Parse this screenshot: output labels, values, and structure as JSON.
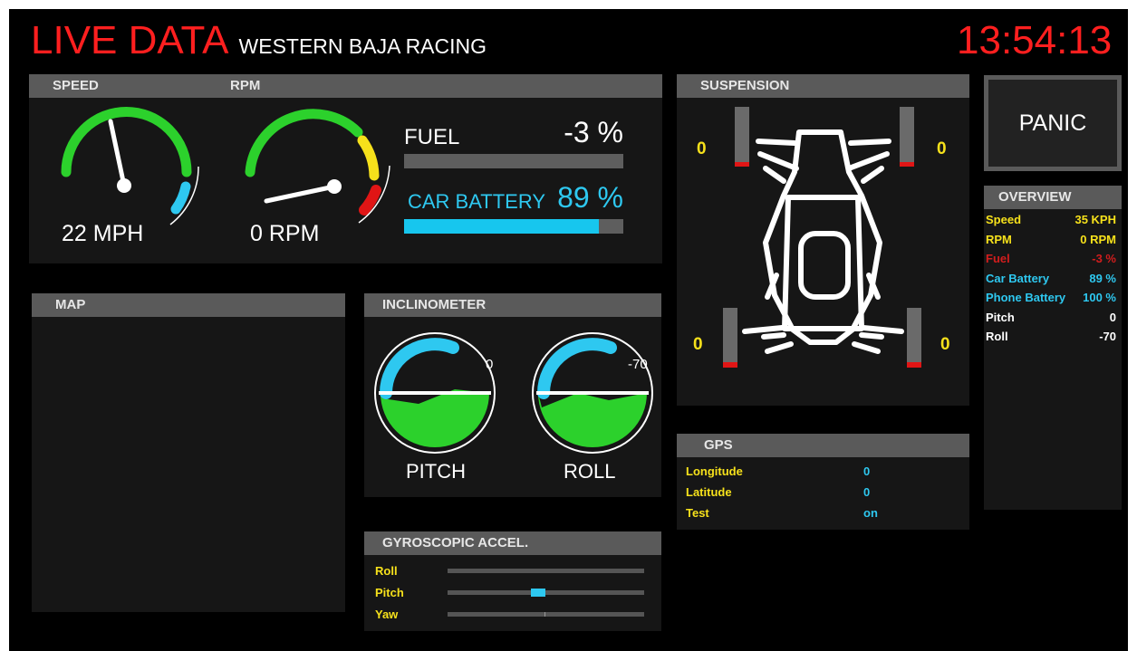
{
  "header": {
    "live_title": "LIVE DATA",
    "team_name": "WESTERN BAJA RACING",
    "clock": "13:54:13"
  },
  "panels": {
    "speed_label": "SPEED",
    "rpm_label": "RPM",
    "suspension_label": "SUSPENSION",
    "map_label": "MAP",
    "inclinometer_label": "INCLINOMETER",
    "gps_label": "GPS",
    "gyro_label": "GYROSCOPIC ACCEL.",
    "overview_label": "OVERVIEW"
  },
  "gauges": {
    "speed_text": "22 MPH",
    "rpm_text": "0 RPM"
  },
  "fuel": {
    "label": "FUEL",
    "value": "-3 %",
    "fraction": 0.0
  },
  "battery": {
    "label": "CAR BATTERY",
    "value": "89 %",
    "fraction": 0.89
  },
  "panic_label": "PANIC",
  "suspension": {
    "front_left": "0",
    "front_right": "0",
    "rear_left": "0",
    "rear_right": "0"
  },
  "overview": {
    "rows": [
      {
        "label": "Speed",
        "value": "35 KPH",
        "color": "#f6e11b"
      },
      {
        "label": "RPM",
        "value": "0 RPM",
        "color": "#f6e11b"
      },
      {
        "label": "Fuel",
        "value": "-3 %",
        "color": "#d21d1d"
      },
      {
        "label": "Car Battery",
        "value": "89 %",
        "color": "#2ec8f0"
      },
      {
        "label": "Phone Battery",
        "value": "100 %",
        "color": "#2ec8f0"
      },
      {
        "label": "Pitch",
        "value": "0",
        "color": "#ffffff"
      },
      {
        "label": "Roll",
        "value": "-70",
        "color": "#ffffff"
      }
    ]
  },
  "inclinometer": {
    "pitch_value": "0",
    "pitch_label": "PITCH",
    "roll_value": "-70",
    "roll_label": "ROLL"
  },
  "gps": {
    "rows": [
      {
        "label": "Longitude",
        "value": "0"
      },
      {
        "label": "Latitude",
        "value": "0"
      },
      {
        "label": "Test",
        "value": "on"
      }
    ]
  },
  "gyro": {
    "roll_label": "Roll",
    "pitch_label": "Pitch",
    "yaw_label": "Yaw"
  },
  "colors": {
    "accent_red": "#ff1f1f",
    "gauge_green": "#2cd12c",
    "gauge_yellow": "#f6e11b",
    "gauge_cyan": "#2ec8f0",
    "suspension_bar": "#6a6a6a",
    "suspension_tip": "#e01515"
  }
}
